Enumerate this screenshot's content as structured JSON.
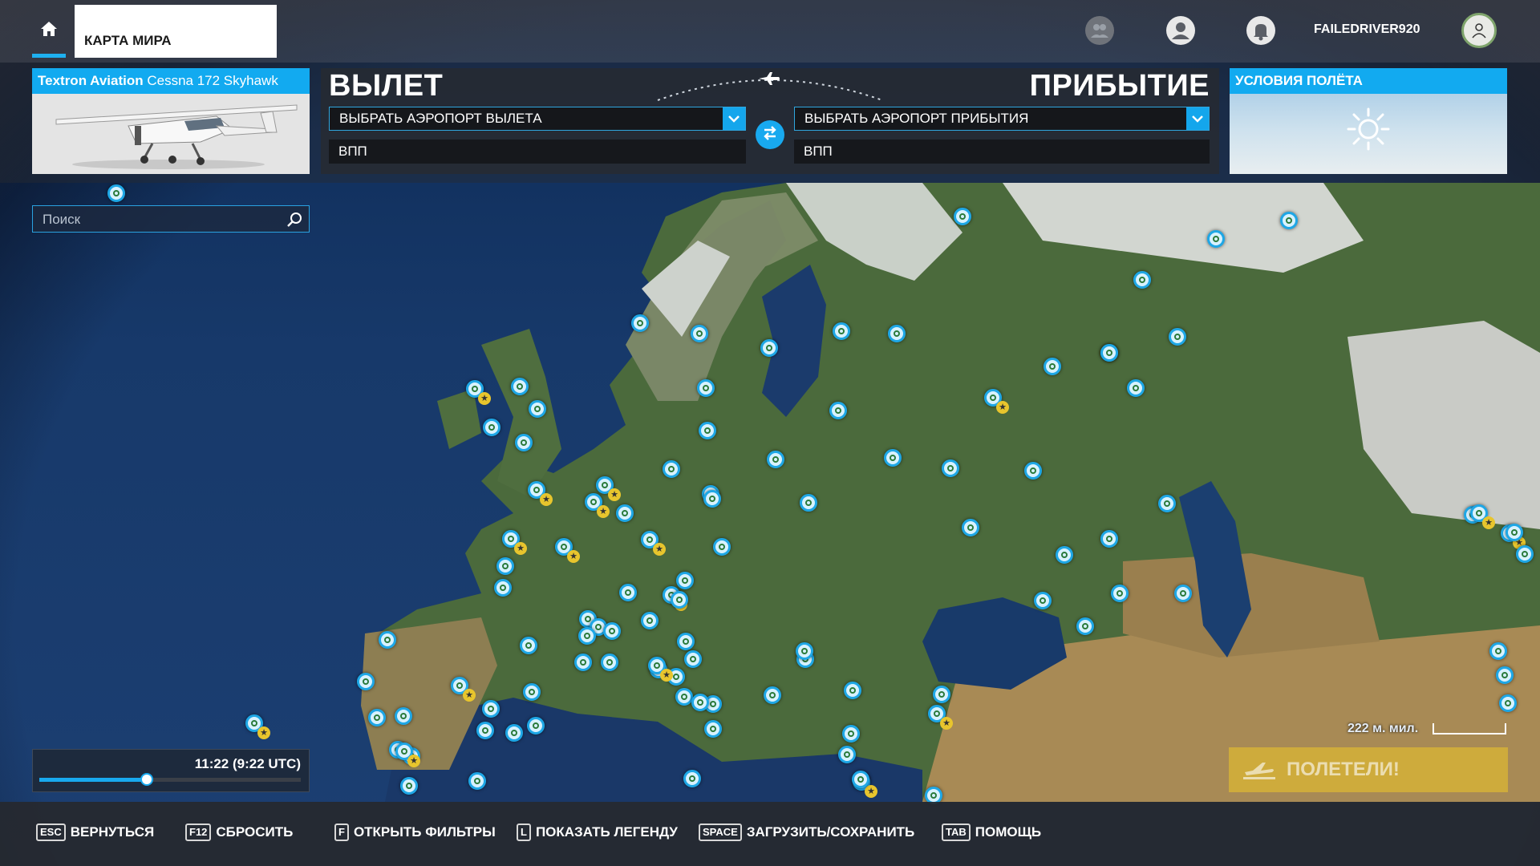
{
  "topbar": {
    "home_icon": "home-icon",
    "tab_label": "КАРТА МИРА",
    "username": "FAILEDRIVER920",
    "icons": [
      "group-icon",
      "profile-icon",
      "notification-bell-icon",
      "avatar"
    ]
  },
  "aircraft": {
    "manufacturer": "Textron Aviation",
    "model": "Cessna 172 Skyhawk"
  },
  "route": {
    "departure_title": "ВЫЛЕТ",
    "arrival_title": "ПРИБЫТИЕ",
    "departure_select": "ВЫБРАТЬ АЭРОПОРТ ВЫЛЕТА",
    "arrival_select": "ВЫБРАТЬ АЭРОПОРТ ПРИБЫТИЯ",
    "departure_runway": "ВПП",
    "arrival_runway": "ВПП",
    "swap_icon": "swap-arrows-icon"
  },
  "weather": {
    "title": "УСЛОВИЯ ПОЛЁТА",
    "icon": "sun-icon"
  },
  "search": {
    "placeholder": "Поиск"
  },
  "time": {
    "label": "11:22 (9:22 UTC)",
    "progress": 0.41
  },
  "scale": {
    "label": "222 м. мил."
  },
  "fly_button": {
    "label": "ПОЛЕТЕЛИ!",
    "icon": "plane-takeoff-icon"
  },
  "bottom_hints": [
    {
      "key": "ESC",
      "label": "ВЕРНУТЬСЯ"
    },
    {
      "key": "F12",
      "label": "СБРОСИТЬ"
    },
    {
      "key": "F",
      "label": "ОТКРЫТЬ ФИЛЬТРЫ"
    },
    {
      "key": "L",
      "label": "ПОКАЗАТЬ ЛЕГЕНДУ"
    },
    {
      "key": "SPACE",
      "label": "ЗАГРУЗИТЬ/СОХРАНИТЬ"
    },
    {
      "key": "TAB",
      "label": "ПОМОЩЬ"
    }
  ],
  "colors": {
    "accent": "#12aaf0",
    "fly_button": "#ecc628",
    "marker_ring": "#1ea7e6",
    "favorite_star": "#e8c52d"
  }
}
